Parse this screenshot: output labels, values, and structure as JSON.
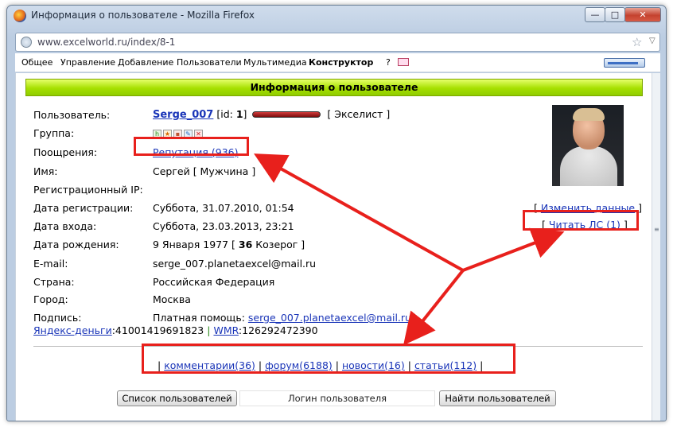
{
  "window": {
    "title": "Информация о пользователе - Mozilla Firefox",
    "min_glyph": "—",
    "max_glyph": "□",
    "close_glyph": "✕"
  },
  "urlbar": {
    "url": "www.excelworld.ru/index/8-1",
    "star_glyph": "☆",
    "drop_glyph": "▽"
  },
  "nav": {
    "items": [
      "Общее",
      "Управление",
      "Добавление",
      "Пользователи",
      "Мультимедиа",
      "Конструктор",
      "?"
    ]
  },
  "page": {
    "header": "Информация о пользователе",
    "fields": {
      "user_label": "Пользователь:",
      "username": "Serge_007",
      "id_prefix": "[id:",
      "id_value": "1",
      "id_suffix": "]",
      "rank": "[ Экселист ]",
      "group_label": "Группа:",
      "awards_label": "Поощрения:",
      "reputation": "Репутация (936)",
      "name_label": "Имя:",
      "name_value": "Сергей [ Мужчина ]",
      "reg_ip_label": "Регистрационный IP:",
      "reg_date_label": "Дата регистрации:",
      "reg_date_value": "Суббота, 31.07.2010, 01:54",
      "login_date_label": "Дата входа:",
      "login_date_value": "Суббота, 23.03.2013, 23:21",
      "birth_label": "Дата рождения:",
      "birth_value_pre": "9 Января 1977 [",
      "birth_age": "36",
      "birth_value_post": "Козерог ]",
      "email_label": "E-mail:",
      "email_value": "serge_007.planetaexcel@mail.ru",
      "country_label": "Страна:",
      "country_value": "Российская Федерация",
      "city_label": "Город:",
      "city_value": "Москва",
      "signature_label": "Подпись:",
      "signature_text": "Платная помощь:",
      "signature_link": "serge_007.planetaexcel@mail.ru",
      "yandex_link": "Яндекс-деньги",
      "yandex_value": ":41001419691823",
      "sep": "|",
      "wmr_link": "WMR",
      "wmr_value": ":126292472390"
    },
    "edit_link": "Изменить данные",
    "read_pm_link": "Читать ЛС (1)",
    "bracket_open": "[",
    "bracket_close": "]",
    "stats": {
      "comments": "комментарии(36)",
      "forum": "форум(6188)",
      "news": "новости(16)",
      "articles": "статьи(112)",
      "sep": "|"
    },
    "buttons": {
      "user_list": "Список пользователей",
      "login_placeholder": "Логин пользователя",
      "find_users": "Найти пользователей"
    }
  },
  "colors": {
    "highlight": "#e8201c",
    "header_green": "#a6e000",
    "link": "#1a35b8"
  }
}
